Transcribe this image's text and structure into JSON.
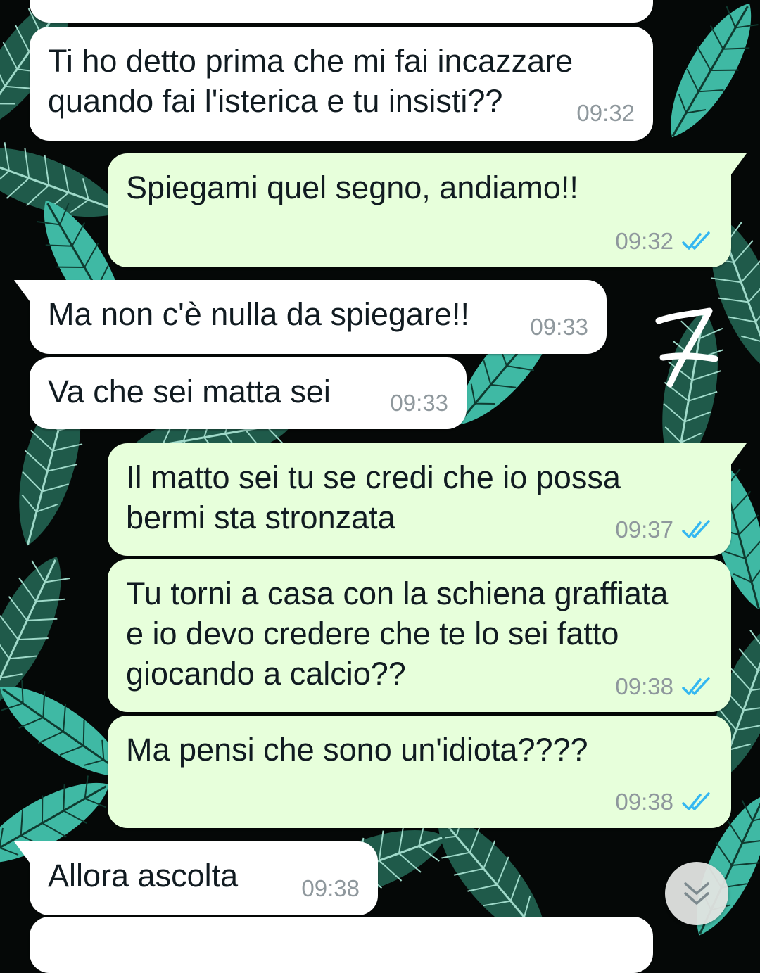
{
  "colors": {
    "incoming_bubble": "#ffffff",
    "outgoing_bubble": "#e7ffdb",
    "text": "#111b21",
    "time": "#8f989d",
    "read_ticks": "#34b7f1",
    "wallpaper_bg": "#050807",
    "leaf_dark": "#1f5a4a",
    "leaf_light": "#3fb9a4"
  },
  "chat": {
    "messages": [
      {
        "direction": "incoming",
        "text": "Ti ho detto prima che mi fai incazzare\nquando fai l'isterica e tu insisti??",
        "time": "09:32"
      },
      {
        "direction": "outgoing",
        "text": "Spiegami quel segno, andiamo!!",
        "time": "09:32",
        "status_icon": "double-check-read-icon"
      },
      {
        "direction": "incoming",
        "text": "Ma non c'è nulla da spiegare!!",
        "time": "09:33"
      },
      {
        "direction": "incoming",
        "text": "Va che sei matta sei",
        "time": "09:33"
      },
      {
        "direction": "outgoing",
        "text": "Il matto sei tu se credi che io possa\nbermi sta stronzata",
        "time": "09:37",
        "status_icon": "double-check-read-icon"
      },
      {
        "direction": "outgoing",
        "text": "Tu torni a casa con la schiena graffiata\ne io devo credere che te lo sei fatto\ngiocando a calcio??",
        "time": "09:38",
        "status_icon": "double-check-read-icon"
      },
      {
        "direction": "outgoing",
        "text": "Ma pensi che sono un'idiota????",
        "time": "09:38",
        "status_icon": "double-check-read-icon"
      },
      {
        "direction": "incoming",
        "text": "Allora ascolta",
        "time": "09:38"
      }
    ]
  },
  "scroll_button": {
    "icon": "double-chevron-down-icon"
  },
  "annotation": {
    "icon": "handwritten-seven-scribble"
  }
}
